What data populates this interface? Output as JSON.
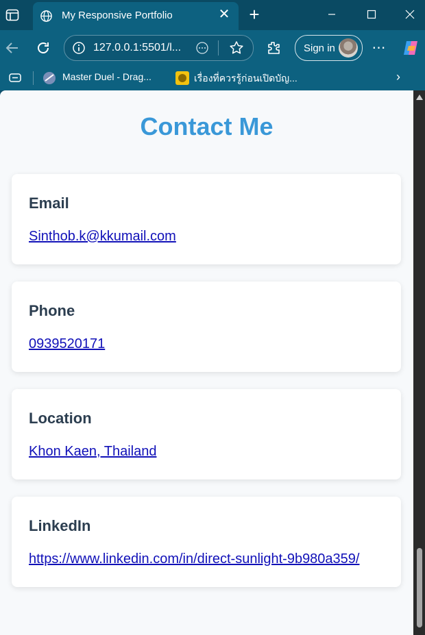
{
  "browser": {
    "tab_title": "My Responsive Portfolio",
    "address": "127.0.0.1:5501/l...",
    "sign_in_label": "Sign in",
    "bookmarks": [
      {
        "label": "Master Duel - Drag..."
      },
      {
        "label": "เรื่องที่ควรรู้ก่อนเปิดบัญ..."
      }
    ]
  },
  "page": {
    "title": "Contact Me",
    "cards": [
      {
        "heading": "Email",
        "link": "Sinthob.k@kkumail.com"
      },
      {
        "heading": "Phone",
        "link": "0939520171"
      },
      {
        "heading": "Location",
        "link": "Khon Kaen, Thailand"
      },
      {
        "heading": "LinkedIn",
        "link": "https://www.linkedin.com/in/direct-sunlight-9b980a359/"
      }
    ]
  },
  "colors": {
    "title": "#3a98d8",
    "heading": "#2c3e50",
    "link": "#1010b8",
    "browser_frame": "#0d6180"
  }
}
